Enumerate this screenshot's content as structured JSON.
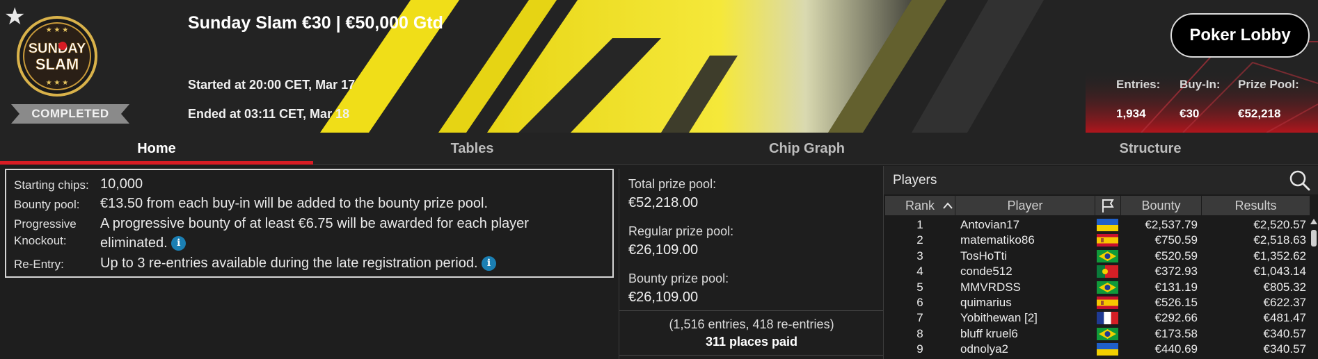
{
  "tournament": {
    "title": "Sunday Slam €30 | €50,000 Gtd",
    "started": "Started at 20:00 CET, Mar 17",
    "ended": "Ended at 03:11 CET, Mar 18",
    "status": "COMPLETED",
    "logo_text_1": "SUNDAY",
    "logo_text_2": "SLAM"
  },
  "header": {
    "favorite_icon": "star-icon",
    "lobby_button": "Poker Lobby",
    "stats": [
      {
        "label": "Entries:",
        "value": "1,934"
      },
      {
        "label": "Buy-In:",
        "value": "€30"
      },
      {
        "label": "Prize Pool:",
        "value": "€52,218"
      }
    ]
  },
  "tabs": [
    {
      "label": "Home",
      "active": true
    },
    {
      "label": "Tables",
      "active": false
    },
    {
      "label": "Chip Graph",
      "active": false
    },
    {
      "label": "Structure",
      "active": false
    }
  ],
  "info": {
    "starting_chips_label": "Starting chips:",
    "starting_chips_value": "10,000",
    "bounty_pool_label": "Bounty pool:",
    "bounty_pool_value": "€13.50 from each buy-in will be added to the bounty prize pool.",
    "progressive_label_1": "Progressive",
    "progressive_label_2": "Knockout:",
    "progressive_value_1": "A progressive bounty of at least €6.75 will be awarded for each player",
    "progressive_value_2": "eliminated.",
    "reentry_label": "Re-Entry:",
    "reentry_value": "Up to 3 re-entries available during the late registration period.",
    "info_icon_glyph": "i"
  },
  "prizes": {
    "total_label": "Total prize pool:",
    "total_value": "€52,218.00",
    "regular_label": "Regular prize pool:",
    "regular_value": "€26,109.00",
    "bounty_label": "Bounty prize pool:",
    "bounty_value": "€26,109.00",
    "entries_text": "(1,516 entries, 418 re-entries)",
    "places_paid": "311 places paid"
  },
  "players": {
    "title": "Players",
    "columns": {
      "rank": "Rank",
      "player": "Player",
      "bounty": "Bounty",
      "results": "Results"
    },
    "sort_icon": "chevron-up-icon",
    "flag_icon": "flag-icon",
    "rows": [
      {
        "rank": "1",
        "name": "Antovian17",
        "flag": "ukraine",
        "bounty": "€2,537.79",
        "result": "€2,520.57"
      },
      {
        "rank": "2",
        "name": "matematiko86",
        "flag": "spain",
        "bounty": "€750.59",
        "result": "€2,518.63"
      },
      {
        "rank": "3",
        "name": "TosHoTti",
        "flag": "brazil",
        "bounty": "€520.59",
        "result": "€1,352.62"
      },
      {
        "rank": "4",
        "name": "conde512",
        "flag": "portugal",
        "bounty": "€372.93",
        "result": "€1,043.14"
      },
      {
        "rank": "5",
        "name": "MMVRDSS",
        "flag": "brazil",
        "bounty": "€131.19",
        "result": "€805.32"
      },
      {
        "rank": "6",
        "name": "quimarius",
        "flag": "spain",
        "bounty": "€526.15",
        "result": "€622.37"
      },
      {
        "rank": "7",
        "name": "Yobithewan [2]",
        "flag": "france",
        "bounty": "€292.66",
        "result": "€481.47"
      },
      {
        "rank": "8",
        "name": "bluff kruel6",
        "flag": "brazil",
        "bounty": "€173.58",
        "result": "€340.57"
      },
      {
        "rank": "9",
        "name": "odnolya2",
        "flag": "ukraine",
        "bounty": "€440.69",
        "result": "€340.57"
      }
    ]
  },
  "colors": {
    "accent_red": "#d71c24",
    "banner_yellow": "#f2e21a",
    "info_blue": "#1b7fb3"
  }
}
